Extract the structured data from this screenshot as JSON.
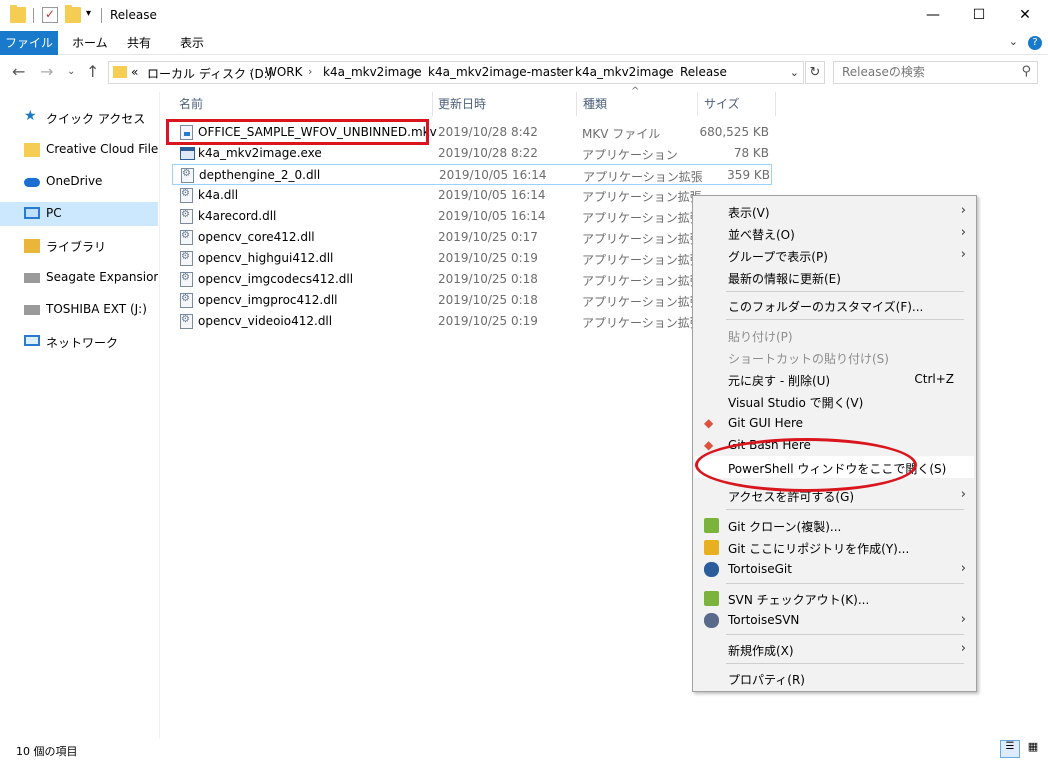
{
  "window": {
    "title": "Release",
    "controls": [
      "—",
      "☐",
      "✕"
    ]
  },
  "ribbon": {
    "tabs": [
      "ファイル",
      "ホーム",
      "共有",
      "表示"
    ],
    "help": "?"
  },
  "address": {
    "segments": [
      "«",
      "ローカル ディスク (D:)",
      "WORK",
      "k4a_mkv2image",
      "k4a_mkv2image-master",
      "k4a_mkv2image",
      "Release"
    ]
  },
  "search": {
    "placeholder": "Releaseの検索"
  },
  "nav": {
    "items": [
      {
        "label": "クイック アクセス"
      },
      {
        "label": "Creative Cloud Files"
      },
      {
        "label": "OneDrive"
      },
      {
        "label": "PC"
      },
      {
        "label": "ライブラリ"
      },
      {
        "label": "Seagate Expansion Drive"
      },
      {
        "label": "TOSHIBA EXT (J:)"
      },
      {
        "label": "ネットワーク"
      }
    ]
  },
  "columns": {
    "name": "名前",
    "date": "更新日時",
    "type": "種類",
    "size": "サイズ"
  },
  "files": [
    {
      "name": "OFFICE_SAMPLE_WFOV_UNBINNED.mkv",
      "date": "2019/10/28 8:42",
      "type": "MKV ファイル",
      "size": "680,525 KB",
      "icon": "mkv"
    },
    {
      "name": "k4a_mkv2image.exe",
      "date": "2019/10/28 8:22",
      "type": "アプリケーション",
      "size": "78 KB",
      "icon": "exe"
    },
    {
      "name": "depthengine_2_0.dll",
      "date": "2019/10/05 16:14",
      "type": "アプリケーション拡張",
      "size": "359 KB",
      "icon": "dll"
    },
    {
      "name": "k4a.dll",
      "date": "2019/10/05 16:14",
      "type": "アプリケーション拡張",
      "size": "",
      "icon": "dll"
    },
    {
      "name": "k4arecord.dll",
      "date": "2019/10/05 16:14",
      "type": "アプリケーション拡張",
      "size": "",
      "icon": "dll"
    },
    {
      "name": "opencv_core412.dll",
      "date": "2019/10/25 0:17",
      "type": "アプリケーション拡張",
      "size": "",
      "icon": "dll"
    },
    {
      "name": "opencv_highgui412.dll",
      "date": "2019/10/25 0:19",
      "type": "アプリケーション拡張",
      "size": "",
      "icon": "dll"
    },
    {
      "name": "opencv_imgcodecs412.dll",
      "date": "2019/10/25 0:18",
      "type": "アプリケーション拡張",
      "size": "",
      "icon": "dll"
    },
    {
      "name": "opencv_imgproc412.dll",
      "date": "2019/10/25 0:18",
      "type": "アプリケーション拡張",
      "size": "",
      "icon": "dll"
    },
    {
      "name": "opencv_videoio412.dll",
      "date": "2019/10/25 0:19",
      "type": "アプリケーション拡張",
      "size": "",
      "icon": "dll"
    }
  ],
  "context_menu": {
    "items": [
      {
        "label": "表示(V)",
        "submenu": true
      },
      {
        "label": "並べ替え(O)",
        "submenu": true
      },
      {
        "label": "グループで表示(P)",
        "submenu": true
      },
      {
        "label": "最新の情報に更新(E)"
      },
      {
        "label": "このフォルダーのカスタマイズ(F)..."
      },
      {
        "label": "貼り付け(P)",
        "disabled": true
      },
      {
        "label": "ショートカットの貼り付け(S)",
        "disabled": true
      },
      {
        "label": "元に戻す - 削除(U)",
        "shortcut": "Ctrl+Z"
      },
      {
        "label": "Visual Studio で開く(V)"
      },
      {
        "label": "Git GUI Here",
        "icon": "git"
      },
      {
        "label": "Git Bash Here",
        "icon": "git"
      },
      {
        "label": "PowerShell ウィンドウをここで開く(S)",
        "highlighted": true
      },
      {
        "label": "アクセスを許可する(G)",
        "submenu": true
      },
      {
        "label": "Git クローン(複製)...",
        "icon": "tortoise-git"
      },
      {
        "label": "Git ここにリポジトリを作成(Y)...",
        "icon": "tortoise-git"
      },
      {
        "label": "TortoiseGit",
        "icon": "tortoise-git",
        "submenu": true
      },
      {
        "label": "SVN チェックアウト(K)...",
        "icon": "tortoise-svn"
      },
      {
        "label": "TortoiseSVN",
        "icon": "tortoise-svn",
        "submenu": true
      },
      {
        "label": "新規作成(X)",
        "submenu": true
      },
      {
        "label": "プロパティ(R)"
      }
    ]
  },
  "status": {
    "count": "10 個の項目"
  },
  "colors": {
    "accent": "#1979ca",
    "annotation": "#d9161e",
    "selection": "#cce8ff"
  }
}
